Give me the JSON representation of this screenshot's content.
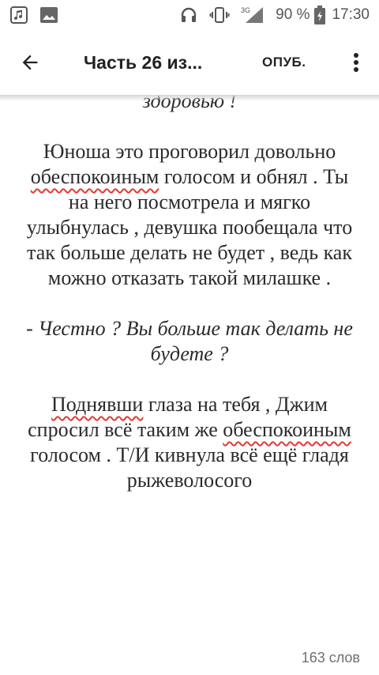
{
  "status_bar": {
    "battery": "90 %",
    "time": "17:30",
    "network": "3G"
  },
  "toolbar": {
    "title": "Часть 26 из...",
    "publish_label": "ОПУБ."
  },
  "content": {
    "prev_line": "здоровью !",
    "paragraph1": {
      "part1": "Юноша это проговорил довольно ",
      "word1": "обеспокоиным",
      "part2": " голосом и обнял . Ты на него посмотрела и мягко улыбнулась , девушка пообещала что так больше делать не будет , ведь как можно отказать такой милашке ."
    },
    "dialogue": "- Честно ? Вы больше так делать не будете ?",
    "paragraph2": {
      "word1": "Поднявши",
      "part1": " глаза на тебя , Джим спросил всё таким же ",
      "word2": "обеспокоиным",
      "part2": " голосом . Т/И кивнула всё ещё гладя рыжеволосого"
    }
  },
  "footer": {
    "word_count": "163 слов"
  }
}
